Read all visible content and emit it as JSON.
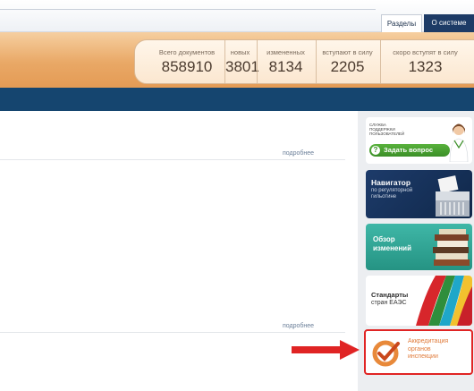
{
  "header": {
    "tab_sections": "Разделы",
    "tab_about": "О системе"
  },
  "stats": [
    {
      "label": "Всего документов",
      "value": "858910"
    },
    {
      "label": "новых",
      "value": "3801"
    },
    {
      "label": "измененных",
      "value": "8134"
    },
    {
      "label": "вступают в силу",
      "value": "2205"
    },
    {
      "label": "скоро вступят в силу",
      "value": "1323"
    }
  ],
  "main": {
    "more_1": "подробнее",
    "more_2": "подробнее"
  },
  "sidebar": {
    "support_caption": "СЛУЖБА ПОДДЕРЖКИ ПОЛЬЗОВАТЕЛЕЙ",
    "support_button": "Задать вопрос",
    "navigator_title": "Навигатор",
    "navigator_sub": "по регуляторной гильотине",
    "review_title": "Обзор изменений",
    "standards_title": "Стандарты",
    "standards_sub": "стран ЕАЭС",
    "accreditation_line1": "Аккредитация",
    "accreditation_line2": "органов",
    "accreditation_line3": "инспекции"
  },
  "colors": {
    "blue_band": "#15456f",
    "orange_band": "#e9a866",
    "highlight_border": "#e02424",
    "arrow": "#e02424"
  }
}
